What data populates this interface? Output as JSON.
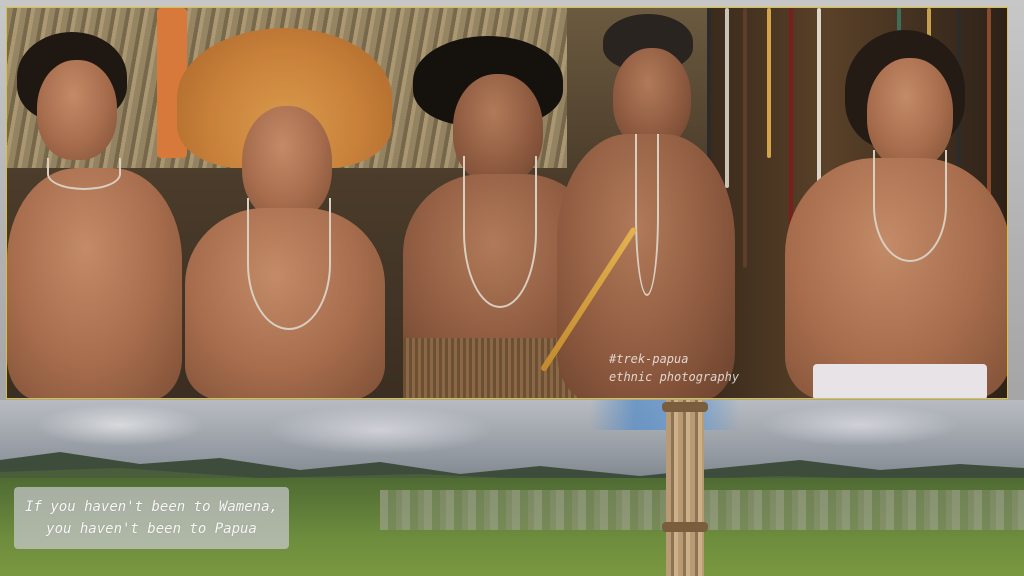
{
  "top_photo": {
    "watermark_line1": "#trek-papua",
    "watermark_line2": "ethnic photography",
    "border_color": "#d9c13a"
  },
  "bottom_photo": {
    "caption_line1": "If you haven't been to Wamena,",
    "caption_line2": "you haven't been to Papua"
  }
}
